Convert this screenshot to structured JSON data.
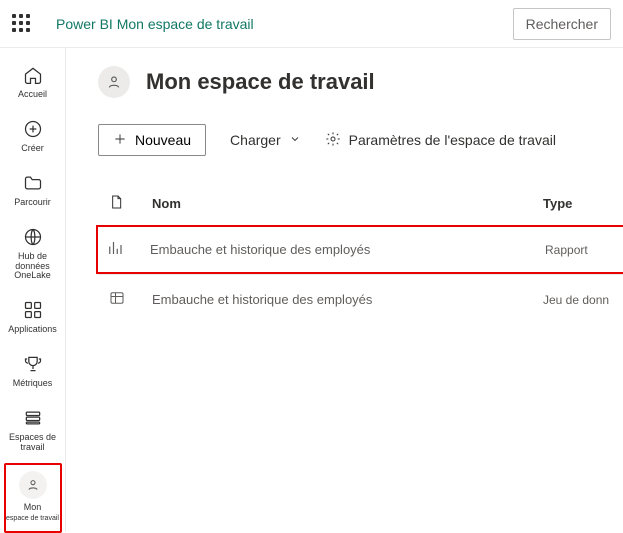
{
  "topbar": {
    "breadcrumb": "Power BI Mon espace de travail",
    "search_label": "Rechercher"
  },
  "sidenav": {
    "home": "Accueil",
    "create": "Créer",
    "browse": "Parcourir",
    "datahub": "Hub de données OneLake",
    "apps": "Applications",
    "metrics": "Métriques",
    "workspaces": "Espaces de travail",
    "my_workspace_line1": "Mon",
    "my_workspace_line2": "espace de travail"
  },
  "workspace": {
    "title": "Mon espace de travail"
  },
  "toolbar": {
    "new_label": "Nouveau",
    "upload_label": "Charger",
    "settings_label": "Paramètres de l'espace de travail"
  },
  "list": {
    "header_name": "Nom",
    "header_type": "Type",
    "rows": [
      {
        "name": "Embauche et historique des employés",
        "type": "Rapport"
      },
      {
        "name": "Embauche et historique des employés",
        "type": "Jeu de donn"
      }
    ]
  }
}
